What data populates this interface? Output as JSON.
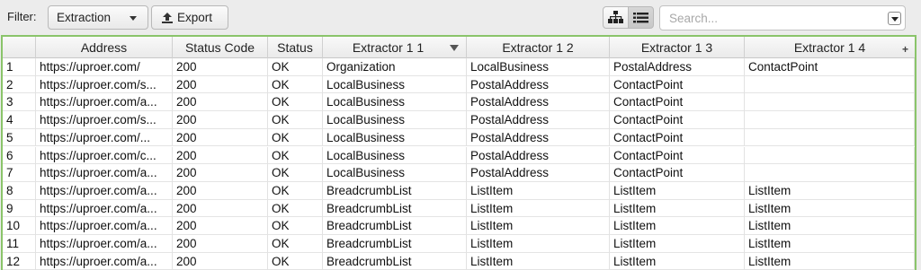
{
  "toolbar": {
    "filter_label": "Filter:",
    "filter_value": "Extraction",
    "export_label": "Export",
    "search_placeholder": "Search..."
  },
  "table": {
    "columns": [
      "",
      "Address",
      "Status Code",
      "Status",
      "Extractor 1 1",
      "Extractor 1 2",
      "Extractor 1 3",
      "Extractor 1 4"
    ],
    "rows": [
      [
        "1",
        "https://uproer.com/",
        "200",
        "OK",
        "Organization",
        "LocalBusiness",
        "PostalAddress",
        "ContactPoint"
      ],
      [
        "2",
        "https://uproer.com/s...",
        "200",
        "OK",
        "LocalBusiness",
        "PostalAddress",
        "ContactPoint",
        ""
      ],
      [
        "3",
        "https://uproer.com/a...",
        "200",
        "OK",
        "LocalBusiness",
        "PostalAddress",
        "ContactPoint",
        ""
      ],
      [
        "4",
        "https://uproer.com/s...",
        "200",
        "OK",
        "LocalBusiness",
        "PostalAddress",
        "ContactPoint",
        ""
      ],
      [
        "5",
        "https://uproer.com/...",
        "200",
        "OK",
        "LocalBusiness",
        "PostalAddress",
        "ContactPoint",
        ""
      ],
      [
        "6",
        "https://uproer.com/c...",
        "200",
        "OK",
        "LocalBusiness",
        "PostalAddress",
        "ContactPoint",
        ""
      ],
      [
        "7",
        "https://uproer.com/a...",
        "200",
        "OK",
        "LocalBusiness",
        "PostalAddress",
        "ContactPoint",
        ""
      ],
      [
        "8",
        "https://uproer.com/a...",
        "200",
        "OK",
        "BreadcrumbList",
        "ListItem",
        "ListItem",
        "ListItem"
      ],
      [
        "9",
        "https://uproer.com/a...",
        "200",
        "OK",
        "BreadcrumbList",
        "ListItem",
        "ListItem",
        "ListItem"
      ],
      [
        "10",
        "https://uproer.com/a...",
        "200",
        "OK",
        "BreadcrumbList",
        "ListItem",
        "ListItem",
        "ListItem"
      ],
      [
        "11",
        "https://uproer.com/a...",
        "200",
        "OK",
        "BreadcrumbList",
        "ListItem",
        "ListItem",
        "ListItem"
      ],
      [
        "12",
        "https://uproer.com/a...",
        "200",
        "OK",
        "BreadcrumbList",
        "ListItem",
        "ListItem",
        "ListItem"
      ]
    ]
  },
  "colors": {
    "table_border": "#8ac46a",
    "header_bg": "#eaeaea"
  }
}
